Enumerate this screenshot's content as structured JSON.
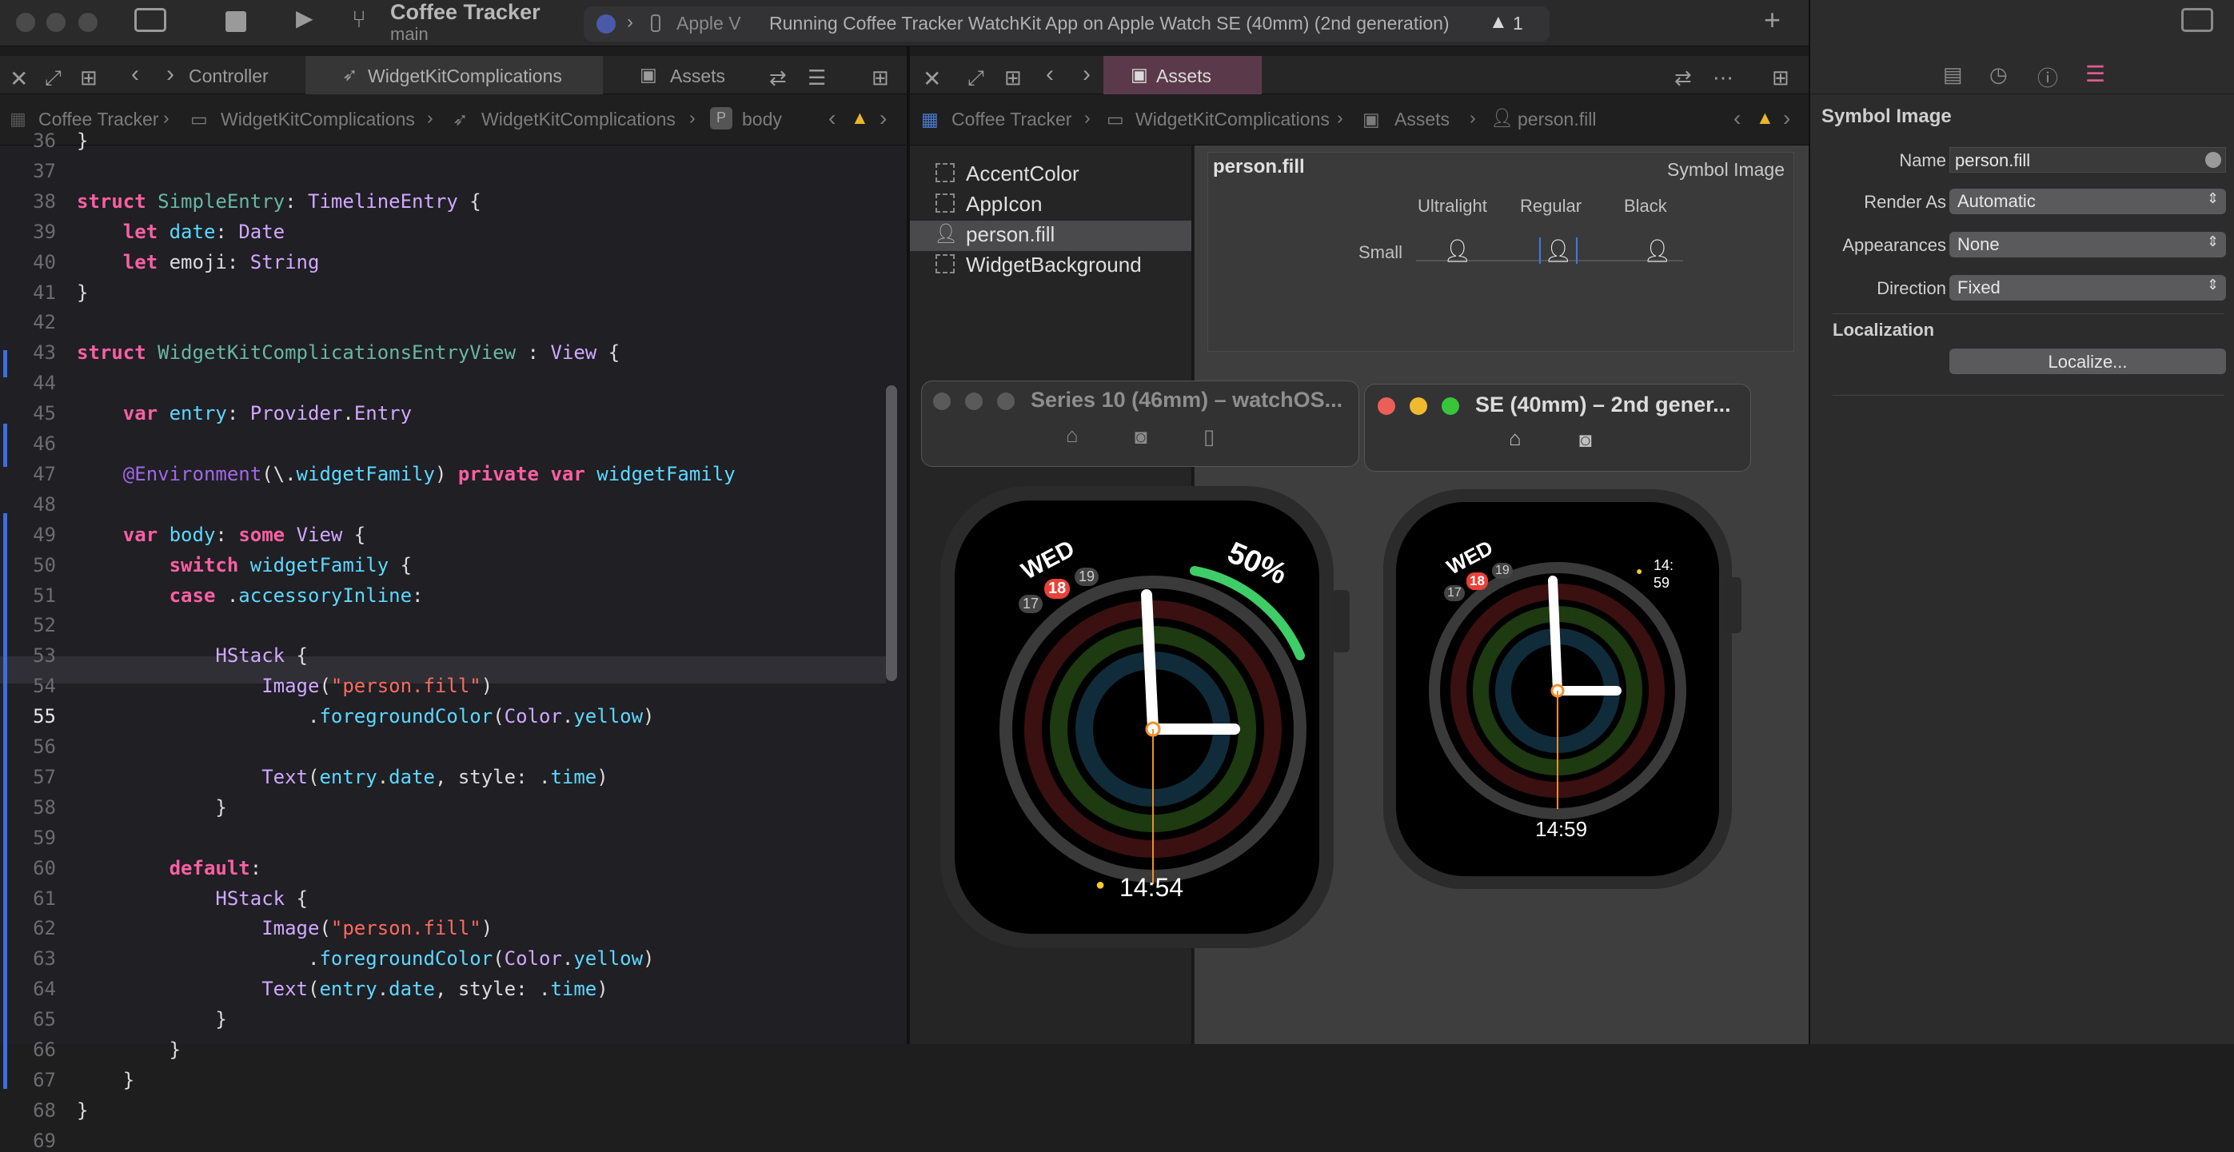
{
  "toolbar": {
    "project": "Coffee Tracker",
    "branch": "main",
    "destination": "Apple V",
    "status": "Running Coffee Tracker WatchKit App on Apple Watch SE (40mm) (2nd generation)",
    "warnings": "1",
    "add": "+"
  },
  "left_tabs": [
    "Controller",
    "WidgetKitComplications",
    "Assets"
  ],
  "right_tabs": [
    "Assets"
  ],
  "left_crumbs": [
    "Coffee Tracker",
    "WidgetKitComplications",
    "WidgetKitComplications",
    "body"
  ],
  "right_crumbs": [
    "Coffee Tracker",
    "WidgetKitComplications",
    "Assets",
    "person.fill"
  ],
  "code": {
    "first_line": 36,
    "lines": [
      "}",
      "",
      "struct SimpleEntry: TimelineEntry {",
      "    let date: Date",
      "    let emoji: String",
      "}",
      "",
      "struct WidgetKitComplicationsEntryView : View {",
      "",
      "    var entry: Provider.Entry",
      "",
      "    @Environment(\\.widgetFamily) private var widgetFamily",
      "",
      "    var body: some View {",
      "        switch widgetFamily {",
      "        case .accessoryInline:",
      "",
      "            HStack {",
      "                Image(\"person.fill\")",
      "                    .foregroundColor(Color.yellow)",
      "",
      "                Text(entry.date, style: .time)",
      "            }",
      "",
      "        default:",
      "            HStack {",
      "                Image(\"person.fill\")",
      "                    .foregroundColor(Color.yellow)",
      "                Text(entry.date, style: .time)",
      "            }",
      "        }",
      "    }",
      "}",
      ""
    ]
  },
  "assets": [
    "AccentColor",
    "AppIcon",
    "person.fill",
    "WidgetBackground"
  ],
  "symbol": {
    "name": "person.fill",
    "kind": "Symbol Image",
    "weights": [
      "Ultralight",
      "Regular",
      "Black"
    ],
    "scale": "Small"
  },
  "sim1": {
    "title": "Series 10 (46mm) – watchOS...",
    "day": "WED",
    "dates": [
      "17",
      "18",
      "19"
    ],
    "battery": "50%",
    "time": "14:54"
  },
  "sim2": {
    "title": "SE (40mm) – 2nd gener...",
    "day": "WED",
    "dates": [
      "17",
      "18",
      "19"
    ],
    "corner_time": "14:\n59",
    "time": "14:59"
  },
  "inspector": {
    "title": "Symbol Image",
    "name_label": "Name",
    "name_value": "person.fill",
    "render_label": "Render As",
    "render_value": "Automatic",
    "appear_label": "Appearances",
    "appear_value": "None",
    "dir_label": "Direction",
    "dir_value": "Fixed",
    "loc_title": "Localization",
    "loc_button": "Localize..."
  }
}
